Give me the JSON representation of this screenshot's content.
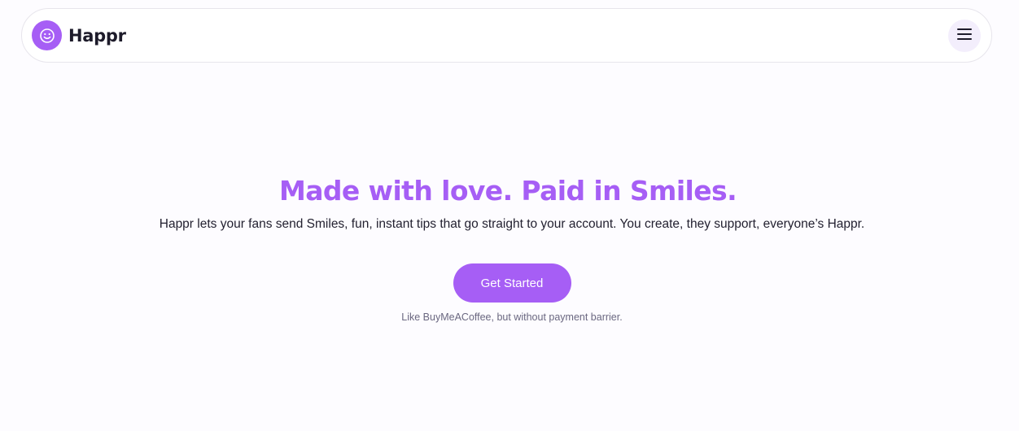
{
  "header": {
    "brand_name": "Happr",
    "logo_icon": "smiley-icon",
    "menu_icon": "hamburger-menu-icon"
  },
  "hero": {
    "title": "Made with love. Paid in Smiles.",
    "subtitle": "Happr lets your fans send Smiles, fun, instant tips that go straight to your account. You create, they support, everyone’s Happr.",
    "cta_label": "Get Started",
    "footnote": "Like BuyMeACoffee, but without payment barrier."
  },
  "colors": {
    "accent": "#a65ef5",
    "text_dark": "#1d1b2a",
    "text_muted": "#6a6780",
    "menu_bg": "#f3eefc"
  }
}
